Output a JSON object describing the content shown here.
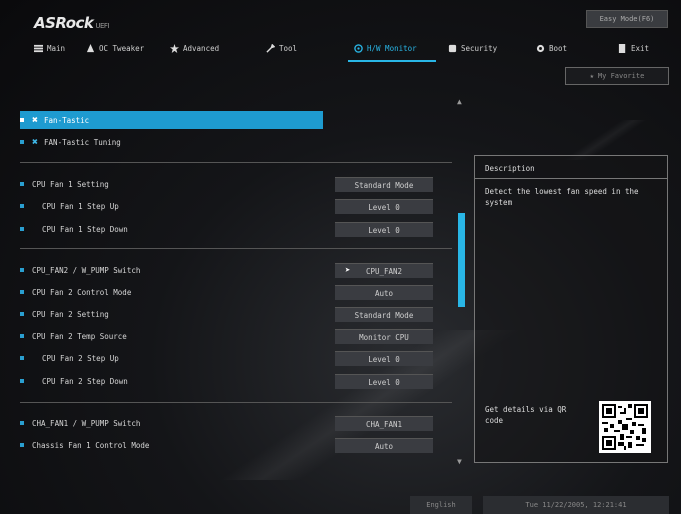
{
  "brand": {
    "logo": "ASRock",
    "logo_suffix": "UEFI"
  },
  "easy_mode_label": "Easy Mode(F6)",
  "nav_tabs": [
    {
      "label": "Main",
      "icon": "list-icon"
    },
    {
      "label": "OC Tweaker",
      "icon": "oc-icon"
    },
    {
      "label": "Advanced",
      "icon": "star-icon"
    },
    {
      "label": "Tool",
      "icon": "tool-icon"
    },
    {
      "label": "H/W Monitor",
      "icon": "monitor-icon",
      "active": true
    },
    {
      "label": "Security",
      "icon": "shield-icon"
    },
    {
      "label": "Boot",
      "icon": "power-icon"
    },
    {
      "label": "Exit",
      "icon": "exit-icon"
    }
  ],
  "favorite_label": "My Favorite",
  "menu": {
    "fan_tastic": "Fan-Tastic",
    "fan_tastic_tuning": "FAN-Tastic Tuning",
    "rows": [
      {
        "label": "CPU Fan 1 Setting",
        "value": "Standard Mode"
      },
      {
        "label": "CPU Fan 1 Step Up",
        "value": "Level 0"
      },
      {
        "label": "CPU Fan 1 Step Down",
        "value": "Level 0"
      },
      {
        "label": "CPU_FAN2 / W_PUMP Switch",
        "value": "CPU_FAN2"
      },
      {
        "label": "CPU Fan 2 Control Mode",
        "value": "Auto"
      },
      {
        "label": "CPU Fan 2 Setting",
        "value": "Standard Mode"
      },
      {
        "label": "CPU Fan 2 Temp Source",
        "value": "Monitor CPU"
      },
      {
        "label": "CPU Fan 2 Step Up",
        "value": "Level 0"
      },
      {
        "label": "CPU Fan 2 Step Down",
        "value": "Level 0"
      },
      {
        "label": "CHA_FAN1 / W_PUMP Switch",
        "value": "CHA_FAN1"
      },
      {
        "label": "Chassis Fan 1 Control Mode",
        "value": "Auto"
      }
    ]
  },
  "description": {
    "title": "Description",
    "text": "Detect the lowest fan speed in the system",
    "qr_text": "Get details via QR code"
  },
  "footer": {
    "language": "English",
    "datetime": "Tue 11/22/2005, 12:21:41"
  },
  "colors": {
    "accent": "#29b6e6",
    "button_bg": "#3a3c41"
  }
}
